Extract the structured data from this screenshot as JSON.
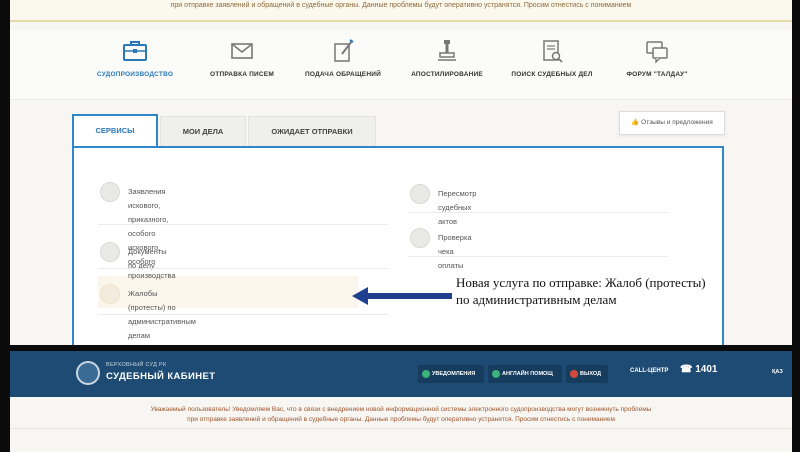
{
  "top_notice": {
    "line2": "при отправке заявлений и обращений в судебные органы. Данные проблемы будут оперативно устранятся. Просим отнестись с пониманием"
  },
  "nav": {
    "items": [
      {
        "label": "СУДОПРОИЗВОДСТВО",
        "icon": "briefcase-icon",
        "active": true
      },
      {
        "label": "ОТПРАВКА ПИСЕМ",
        "icon": "envelope-icon",
        "active": false
      },
      {
        "label": "ПОДАЧА ОБРАЩЕНИЙ",
        "icon": "document-pen-icon",
        "active": false
      },
      {
        "label": "АПОСТИЛИРОВАНИЕ",
        "icon": "stamp-icon",
        "active": false
      },
      {
        "label": "ПОИСК СУДЕБНЫХ ДЕЛ",
        "icon": "search-document-icon",
        "active": false
      },
      {
        "label": "ФОРУМ \"ТАЛДАУ\"",
        "icon": "chat-icon",
        "active": false
      }
    ]
  },
  "feedback_button": "Отзывы и предложения",
  "tabs": [
    {
      "label": "СЕРВИСЫ",
      "active": true
    },
    {
      "label": "МОИ ДЕЛА",
      "active": false
    },
    {
      "label": "ОЖИДАЕТ ОТПРАВКИ",
      "active": false
    }
  ],
  "services": {
    "left": [
      {
        "line1": "Заявления искового, приказного, особого искового,",
        "line2": "особого производства",
        "icon": "pen-icon"
      },
      {
        "line1": "Документы по делу",
        "icon": "document-icon"
      },
      {
        "line1": "Жалобы (протесты) по административным делам",
        "icon": "complaint-icon"
      }
    ],
    "right": [
      {
        "line1": "Пересмотр судебных актов",
        "icon": "review-icon"
      },
      {
        "line1": "Проверка чека оплаты",
        "icon": "receipt-icon"
      }
    ]
  },
  "annotation": "Новая услуга по отправке: Жалоб (протесты) по административным делам",
  "header2": {
    "brand_sub": "ВЕРХОВНЫЙ СУД РК",
    "brand_main": "СУДЕБНЫЙ КАБИНЕТ",
    "btn_notifications": "УВЕДОМЛЕНИЯ",
    "btn_helper": "АНГЛАЙН ПОМОЩ",
    "btn_exit": "ВЫХОД",
    "call_center_label": "CALL-ЦЕНТР",
    "call_center_number": "1401",
    "lang": "ҚАЗ"
  },
  "notice2": {
    "line1": "Уважаемый пользователь! Уведомляем Вас, что в связи с внедрением новой информационной системы электронного судопроизводства могут возникнуть проблемы",
    "line2": "при отправке заявлений и обращений в судебные органы. Данные проблемы будут оперативно устранятся. Просим отнестись с пониманием"
  },
  "colors": {
    "accent": "#2f86c9",
    "header_bg": "#1d4b73",
    "notice_text": "#a0552a"
  }
}
